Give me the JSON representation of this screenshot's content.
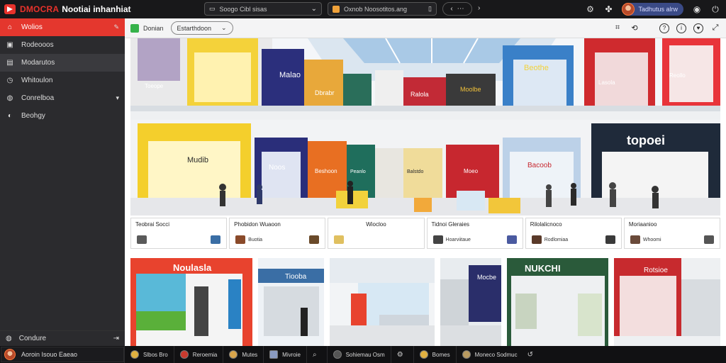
{
  "app": {
    "brand_primary": "DMOCRA",
    "brand_secondary": "Nootiai inhanhiat"
  },
  "topbar": {
    "search": {
      "text": "Soogo Cibl sisas",
      "chevron": "⌄"
    },
    "address": {
      "text": "Oxnob Noosotitos.ang"
    },
    "nav": {
      "back": "‹",
      "more": "⋯",
      "forward": "›"
    },
    "user": {
      "name": "Tadhutus alrw"
    },
    "icons": [
      "gear-icon",
      "puzzle-icon",
      "bell-icon",
      "power-icon"
    ]
  },
  "sidebar": {
    "items": [
      {
        "label": "Wolios",
        "icon": "home-icon",
        "end": "✎",
        "state": "active"
      },
      {
        "label": "Rodeooos",
        "icon": "box-icon",
        "end": "",
        "state": "normal"
      },
      {
        "label": "Modarutos",
        "icon": "folder-icon",
        "end": "",
        "state": "highlight"
      },
      {
        "label": "Whitoulon",
        "icon": "clock-icon",
        "end": "",
        "state": "normal"
      },
      {
        "label": "Conrelboa",
        "icon": "settings-icon",
        "end": "▾",
        "state": "normal"
      },
      {
        "label": "Beohgy",
        "icon": "info-icon",
        "end": "",
        "state": "normal"
      }
    ],
    "bottom": {
      "label": "Condure"
    }
  },
  "toolbar": {
    "label": "Donian",
    "dropdown": "Estarthdoon",
    "icons": [
      "grid-icon",
      "share-icon",
      "help-icon",
      "info-icon",
      "heart-icon",
      "expand-icon"
    ]
  },
  "hero": {
    "stores": [
      "Malao",
      "Dbrabr",
      "Ralola",
      "Moolbe",
      "Beothe",
      "Mudib",
      "Noos",
      "Beshoon",
      "Peanlo",
      "Balstdo",
      "Moeo",
      "Bacoob",
      "Lasola",
      "Reollo",
      "Toeope",
      "topoei"
    ]
  },
  "cards": [
    {
      "title": "Teobrai Socci",
      "sub": "",
      "c1": "#5a5a5a",
      "c2": "#3a6ea5"
    },
    {
      "title": "Phobidon Wuaoon",
      "sub": "Buotia",
      "c1": "#8a4a2a",
      "c2": "#6a4a2a"
    },
    {
      "title": "Wiocloo",
      "sub": "",
      "c1": "#cfd6dd",
      "c2": "#e0c060"
    },
    {
      "title": "Tidnoi Gleraies",
      "sub": "Hoarviitaue",
      "c1": "#444444",
      "c2": "#4a5aa0"
    },
    {
      "title": "Rilolalicnoco",
      "sub": "Rodlomiaa",
      "c1": "#5a3a2a",
      "c2": "#3a3a3a"
    },
    {
      "title": "Moriaanioo",
      "sub": "Whoomi",
      "c1": "#6a4a3a",
      "c2": "#555555"
    }
  ],
  "gallery": [
    {
      "name": "Noulasla"
    },
    {
      "name": "Tiooba"
    },
    {
      "name": ""
    },
    {
      "name": "Mocbe"
    },
    {
      "name": "NUKCHI"
    },
    {
      "name": "Rotsioe"
    }
  ],
  "taskbar": {
    "search_label": "Aoroin Isouo Eaeao",
    "items": [
      {
        "label": "Slbos Bro",
        "glyph": ""
      },
      {
        "label": "Reroemia",
        "glyph": ""
      },
      {
        "label": "Mutes",
        "glyph": ""
      },
      {
        "label": "Mivroie",
        "glyph": ""
      },
      {
        "label": "",
        "glyph": "⌕"
      },
      {
        "label": "Sohiemau Osm",
        "glyph": ""
      },
      {
        "label": "",
        "glyph": "⚙"
      },
      {
        "label": "Bomes",
        "glyph": ""
      },
      {
        "label": "Moneco Sodmuc",
        "glyph": ""
      }
    ]
  }
}
